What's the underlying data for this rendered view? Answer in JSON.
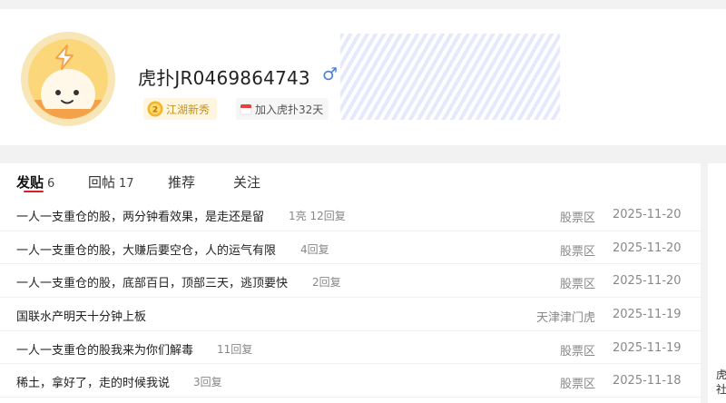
{
  "profile": {
    "username": "虎扑JR0469864743",
    "gender_symbol": "♂",
    "badge_rank_label": "江湖新秀",
    "badge_rank_number": "2",
    "badge_join_label": "加入虎扑32天"
  },
  "tabs": [
    {
      "label": "发贴",
      "count": "6"
    },
    {
      "label": "回帖",
      "count": "17"
    },
    {
      "label": "推荐",
      "count": ""
    },
    {
      "label": "关注",
      "count": ""
    }
  ],
  "posts": [
    {
      "title": "一人一支重仓的股，两分钟看效果，是走还是留",
      "stats": "1亮 12回复",
      "board": "股票区",
      "date": "2025-11-20"
    },
    {
      "title": "一人一支重仓的股，大赚后要空仓，人的运气有限",
      "stats": "4回复",
      "board": "股票区",
      "date": "2025-11-20"
    },
    {
      "title": "一人一支重仓的股，底部百日，顶部三天，逃顶要快",
      "stats": "2回复",
      "board": "股票区",
      "date": "2025-11-20"
    },
    {
      "title": "国联水产明天十分钟上板",
      "stats": "",
      "board": "天津津门虎",
      "date": "2025-11-19"
    },
    {
      "title": "一人一支重仓的股我来为你们解毒",
      "stats": "11回复",
      "board": "股票区",
      "date": "2025-11-19"
    },
    {
      "title": "稀土，拿好了，走的时候我说",
      "stats": "3回复",
      "board": "股票区",
      "date": "2025-11-18"
    }
  ],
  "side_peek": {
    "line1": "虎",
    "line2": "社"
  },
  "colors": {
    "accent_red": "#d4202a",
    "gender_blue": "#4a7fdc",
    "badge_gold": "#c8911a",
    "avatar_orange": "#f3a24a"
  }
}
